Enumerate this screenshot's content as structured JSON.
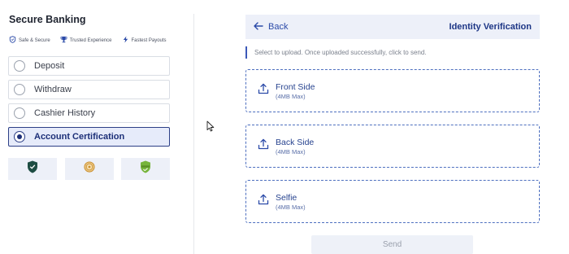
{
  "sidebar": {
    "title": "Secure Banking",
    "badges": [
      {
        "label": "Safe & Secure",
        "icon": "shield-icon"
      },
      {
        "label": "Trusted Experience",
        "icon": "trophy-icon"
      },
      {
        "label": "Fastest Payouts",
        "icon": "lightning-icon"
      }
    ],
    "menu": [
      {
        "label": "Deposit",
        "selected": false
      },
      {
        "label": "Withdraw",
        "selected": false
      },
      {
        "label": "Cashier History",
        "selected": false
      },
      {
        "label": "Account Certification",
        "selected": true
      }
    ],
    "logos": [
      "shield-logo",
      "coin-logo",
      "verified-logo"
    ]
  },
  "verification": {
    "back_label": "Back",
    "title": "Identity Verification",
    "hint": "Select to upload. Once uploaded successfully, click to send.",
    "uploads": [
      {
        "label": "Front Side",
        "note": "(4MB Max)"
      },
      {
        "label": "Back Side",
        "note": "(4MB Max)"
      },
      {
        "label": "Selfie",
        "note": "(4MB Max)"
      }
    ],
    "send_label": "Send"
  },
  "colors": {
    "accent": "#1c2f78",
    "link": "#2b4aa8",
    "panel": "#edf0f9",
    "active_bg": "#e6ebfa"
  }
}
